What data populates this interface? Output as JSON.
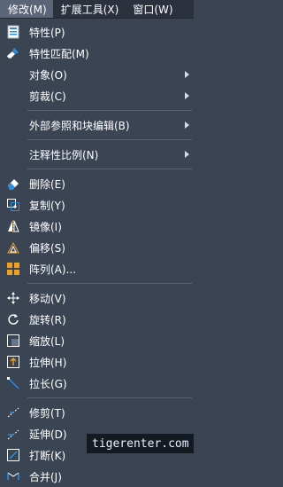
{
  "menubar": {
    "items": [
      {
        "label": "修改(M)",
        "active": true
      },
      {
        "label": "扩展工具(X)",
        "active": false
      },
      {
        "label": "窗口(W)",
        "active": false
      }
    ]
  },
  "menu": {
    "groups": [
      [
        {
          "label": "特性(P)",
          "icon": "properties-icon",
          "submenu": false
        },
        {
          "label": "特性匹配(M)",
          "icon": "match-properties-brush-icon",
          "submenu": false
        },
        {
          "label": "对象(O)",
          "icon": "",
          "submenu": true
        },
        {
          "label": "剪裁(C)",
          "icon": "",
          "submenu": true
        }
      ],
      [
        {
          "label": "外部参照和块编辑(B)",
          "icon": "",
          "submenu": true
        }
      ],
      [
        {
          "label": "注释性比例(N)",
          "icon": "",
          "submenu": true
        }
      ],
      [
        {
          "label": "删除(E)",
          "icon": "eraser-icon",
          "submenu": false
        },
        {
          "label": "复制(Y)",
          "icon": "copy-icon",
          "submenu": false
        },
        {
          "label": "镜像(I)",
          "icon": "mirror-icon",
          "submenu": false
        },
        {
          "label": "偏移(S)",
          "icon": "offset-icon",
          "submenu": false
        },
        {
          "label": "阵列(A)...",
          "icon": "array-icon",
          "submenu": false
        }
      ],
      [
        {
          "label": "移动(V)",
          "icon": "move-icon",
          "submenu": false
        },
        {
          "label": "旋转(R)",
          "icon": "rotate-icon",
          "submenu": false
        },
        {
          "label": "缩放(L)",
          "icon": "scale-icon",
          "submenu": false
        },
        {
          "label": "拉伸(H)",
          "icon": "stretch-icon",
          "submenu": false
        },
        {
          "label": "拉长(G)",
          "icon": "lengthen-icon",
          "submenu": false
        }
      ],
      [
        {
          "label": "修剪(T)",
          "icon": "trim-icon",
          "submenu": false
        },
        {
          "label": "延伸(D)",
          "icon": "extend-icon",
          "submenu": false
        },
        {
          "label": "打断(K)",
          "icon": "break-icon",
          "submenu": false
        },
        {
          "label": "合并(J)",
          "icon": "join-icon",
          "submenu": false
        }
      ]
    ]
  },
  "watermark": "tigerenter.com",
  "colors": {
    "menu_bg": "#3b4453",
    "menubar_bg": "#2b323d",
    "active_menu": "#5a6577",
    "accent_blue": "#2f8de0",
    "accent_orange": "#f0a020"
  }
}
